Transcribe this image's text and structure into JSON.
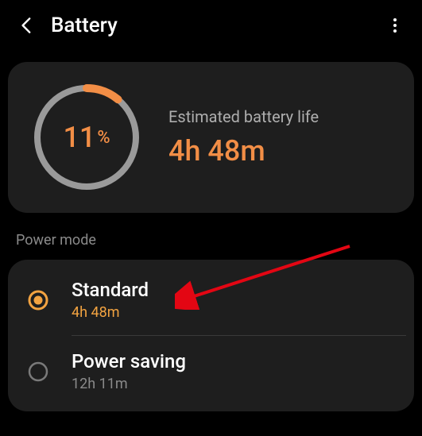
{
  "header": {
    "title": "Battery"
  },
  "battery": {
    "percent_num": "11",
    "percent_sym": "%",
    "est_label": "Estimated battery life",
    "est_time": "4h 48m",
    "percent_value": 11
  },
  "colors": {
    "accent": "#f28e46",
    "ring_track": "#9a9a9a"
  },
  "section": {
    "power_mode": "Power mode"
  },
  "modes": [
    {
      "title": "Standard",
      "sub": "4h 48m",
      "selected": true
    },
    {
      "title": "Power saving",
      "sub": "12h 11m",
      "selected": false
    }
  ]
}
